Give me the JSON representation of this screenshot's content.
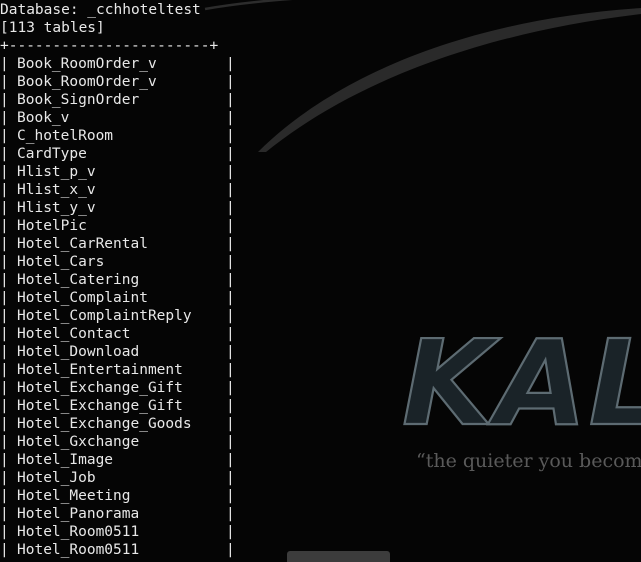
{
  "database_line": "Database: _cchhoteltest",
  "count_line": "[113 tables]",
  "border_line": "+-----------------------+",
  "pipe": "|",
  "tables": [
    "Book_RoomOrder_v",
    "Book_RoomOrder_v",
    "Book_SignOrder",
    "Book_v",
    "C_hotelRoom",
    "CardType",
    "Hlist_p_v",
    "Hlist_x_v",
    "Hlist_y_v",
    "HotelPic",
    "Hotel_CarRental",
    "Hotel_Cars",
    "Hotel_Catering",
    "Hotel_Complaint",
    "Hotel_ComplaintReply",
    "Hotel_Contact",
    "Hotel_Download",
    "Hotel_Entertainment",
    "Hotel_Exchange_Gift",
    "Hotel_Exchange_Gift",
    "Hotel_Exchange_Goods",
    "Hotel_Gxchange",
    "Hotel_Image",
    "Hotel_Job",
    "Hotel_Meeting",
    "Hotel_Panorama",
    "Hotel_Room0511",
    "Hotel_Room0511"
  ],
  "wallpaper": {
    "logo": "KALI",
    "tagline": "“the quieter you become"
  },
  "colors": {
    "background": "#050505",
    "text": "#e8e8e8",
    "logo_fill": "#1a2328",
    "logo_stroke": "#5d6b72",
    "tagline": "#5a5a5a",
    "swoosh": "#2f2f2f"
  }
}
